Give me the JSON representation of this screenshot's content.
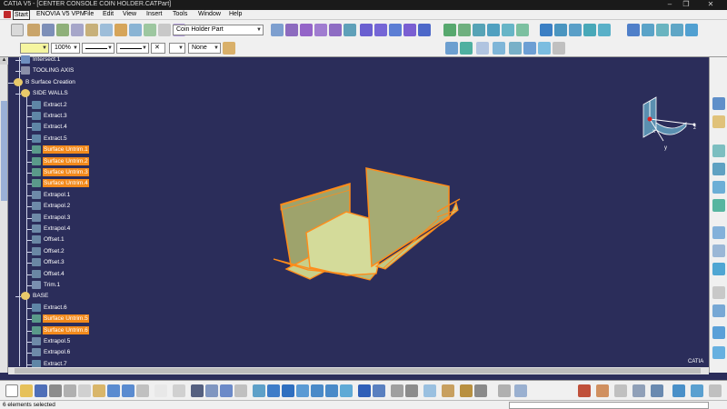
{
  "window": {
    "title": "CATIA V5 - [CENTER CONSOLE COIN HOLDER.CATPart]",
    "min_glyph": "–",
    "max_glyph": "❐",
    "close_glyph": "✕"
  },
  "menu": {
    "items": [
      {
        "label": "Start",
        "active": true
      },
      {
        "label": "ENOVIA V5 VPM"
      },
      {
        "label": "File"
      },
      {
        "label": "Edit"
      },
      {
        "label": "View"
      },
      {
        "label": "Insert"
      },
      {
        "label": "Tools"
      },
      {
        "label": "Window"
      },
      {
        "label": "Help"
      }
    ]
  },
  "toolbar": {
    "part_selector": "Coin Holder Part",
    "zoom_value": "100%",
    "layer_value": "None",
    "thickness_value": "1"
  },
  "tree": {
    "nodes": [
      {
        "label": "Intersect.1",
        "icon": "intersect-icon",
        "selected": false
      },
      {
        "label": "TOOLING AXIS",
        "icon": "axis-icon",
        "selected": false
      },
      {
        "label": "B Surface Creation",
        "icon": "geometrical-set-icon",
        "selected": false
      },
      {
        "label": "SIDE WALLS",
        "icon": "geometrical-set-icon",
        "selected": false
      },
      {
        "label": "Extract.2",
        "icon": "extract-icon",
        "selected": false
      },
      {
        "label": "Extract.3",
        "icon": "extract-icon",
        "selected": false
      },
      {
        "label": "Extract.4",
        "icon": "extract-icon",
        "selected": false
      },
      {
        "label": "Extract.5",
        "icon": "extract-icon",
        "selected": false
      },
      {
        "label": "Surface Untrim.1",
        "icon": "untrim-icon",
        "selected": true
      },
      {
        "label": "Surface Untrim.2",
        "icon": "untrim-icon",
        "selected": true
      },
      {
        "label": "Surface Untrim.3",
        "icon": "untrim-icon",
        "selected": true
      },
      {
        "label": "Surface Untrim.4",
        "icon": "untrim-icon",
        "selected": true
      },
      {
        "label": "Extrapol.1",
        "icon": "extrapol-icon",
        "selected": false
      },
      {
        "label": "Extrapol.2",
        "icon": "extrapol-icon",
        "selected": false
      },
      {
        "label": "Extrapol.3",
        "icon": "extrapol-icon",
        "selected": false
      },
      {
        "label": "Extrapol.4",
        "icon": "extrapol-icon",
        "selected": false
      },
      {
        "label": "Offset.1",
        "icon": "offset-icon",
        "selected": false
      },
      {
        "label": "Offset.2",
        "icon": "offset-icon",
        "selected": false
      },
      {
        "label": "Offset.3",
        "icon": "offset-icon",
        "selected": false
      },
      {
        "label": "Offset.4",
        "icon": "offset-icon",
        "selected": false
      },
      {
        "label": "Trim.1",
        "icon": "trim-icon",
        "selected": false
      },
      {
        "label": "BASE",
        "icon": "geometrical-set-icon",
        "selected": false
      },
      {
        "label": "Extract.6",
        "icon": "extract-icon",
        "selected": false
      },
      {
        "label": "Surface Untrim.5",
        "icon": "untrim-icon",
        "selected": true
      },
      {
        "label": "Surface Untrim.6",
        "icon": "untrim-icon",
        "selected": true
      },
      {
        "label": "Extrapol.5",
        "icon": "extrapol-icon",
        "selected": false
      },
      {
        "label": "Extrapol.6",
        "icon": "extrapol-icon",
        "selected": false
      },
      {
        "label": "Extract.7",
        "icon": "extract-icon",
        "selected": false
      }
    ]
  },
  "compass": {
    "x_label": "x",
    "y_label": "y",
    "z_label": "z"
  },
  "status": {
    "text": "6 elements selected"
  },
  "colors": {
    "background": "#2b2d5a",
    "highlight": "#f28a1c",
    "surface": "#d4db9a"
  },
  "logo": "CATIA"
}
